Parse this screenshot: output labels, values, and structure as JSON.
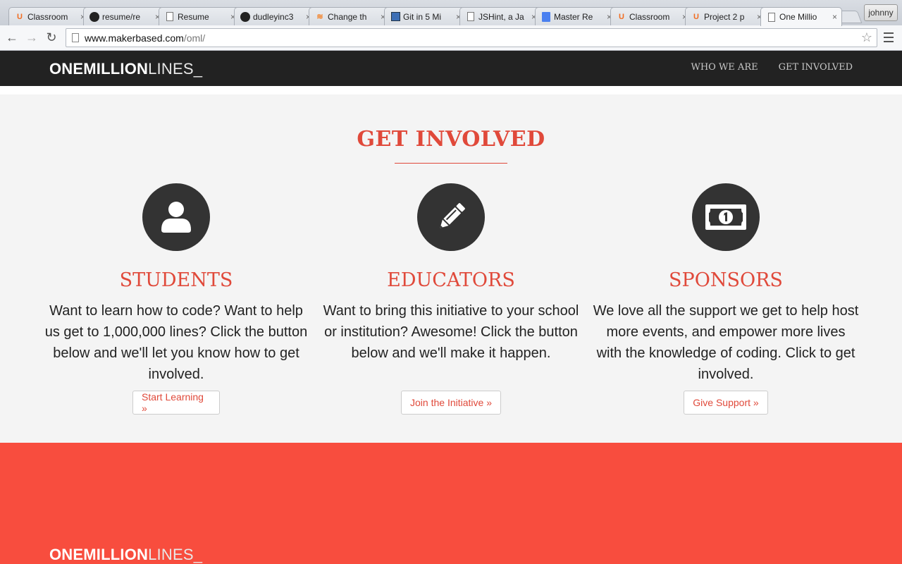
{
  "browser": {
    "tabs": [
      {
        "title": "Classroom",
        "icon": "udacity-icon"
      },
      {
        "title": "resume/re",
        "icon": "github-icon"
      },
      {
        "title": "Resume",
        "icon": "page-icon"
      },
      {
        "title": "dudleyinc3",
        "icon": "github-icon"
      },
      {
        "title": "Change th",
        "icon": "stackoverflow-icon"
      },
      {
        "title": "Git in 5 Mi",
        "icon": "git-icon"
      },
      {
        "title": "JSHint, a Ja",
        "icon": "page-icon"
      },
      {
        "title": "Master Re",
        "icon": "google-docs-icon"
      },
      {
        "title": "Classroom",
        "icon": "udacity-icon"
      },
      {
        "title": "Project 2 p",
        "icon": "udacity-icon"
      },
      {
        "title": "One Millio",
        "icon": "page-icon",
        "active": true
      }
    ],
    "tab_close": "×",
    "user": "johnny",
    "url_host": "www.makerbased.com",
    "url_path": "/oml/"
  },
  "nav": {
    "logo_bold": "ONEMILLION",
    "logo_light": "LINES_",
    "links": [
      "WHO WE ARE",
      "GET INVOLVED"
    ]
  },
  "get_involved": {
    "title": "GET INVOLVED",
    "columns": [
      {
        "icon": "user-icon",
        "heading": "STUDENTS",
        "text": "Want to learn how to code? Want to help us get to 1,000,000 lines? Click the button below and we'll let you know how to get involved.",
        "button": "Start Learning »"
      },
      {
        "icon": "pencil-icon",
        "heading": "EDUCATORS",
        "text": "Want to bring this initiative to your school or institution? Awesome! Click the button below and we'll make it happen.",
        "button": "Join the Initiative »"
      },
      {
        "icon": "money-icon",
        "heading": "SPONSORS",
        "text": "We love all the support we get to help host more events, and empower more lives with the knowledge of coding. Click to get involved.",
        "button": "Give Support »"
      }
    ]
  },
  "footer": {
    "logo_bold": "ONEMILLION",
    "logo_light": "LINES_"
  },
  "colors": {
    "accent": "#e0493a",
    "footer_bg": "#f84d3e",
    "nav_bg": "#222222",
    "icon_circle": "#333333"
  }
}
